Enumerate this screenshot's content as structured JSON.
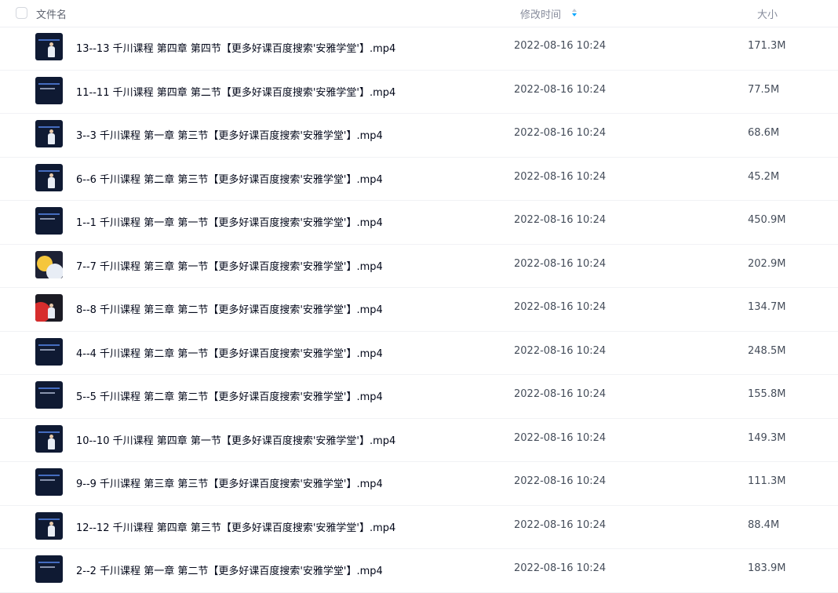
{
  "header": {
    "name_label": "文件名",
    "time_label": "修改时间",
    "size_label": "大小"
  },
  "files": [
    {
      "name": "13--13 千川课程 第四章 第四节【更多好课百度搜索'安雅学堂'】.mp4",
      "time": "2022-08-16 10:24",
      "size": "171.3M",
      "thumb": "presenter"
    },
    {
      "name": "11--11 千川课程 第四章 第二节【更多好课百度搜索'安雅学堂'】.mp4",
      "time": "2022-08-16 10:24",
      "size": "77.5M",
      "thumb": "slide"
    },
    {
      "name": "3--3 千川课程 第一章 第三节【更多好课百度搜索'安雅学堂'】.mp4",
      "time": "2022-08-16 10:24",
      "size": "68.6M",
      "thumb": "presenter"
    },
    {
      "name": "6--6 千川课程 第二章 第三节【更多好课百度搜索'安雅学堂'】.mp4",
      "time": "2022-08-16 10:24",
      "size": "45.2M",
      "thumb": "presenter"
    },
    {
      "name": "1--1 千川课程 第一章 第一节【更多好课百度搜索'安雅学堂'】.mp4",
      "time": "2022-08-16 10:24",
      "size": "450.9M",
      "thumb": "slide"
    },
    {
      "name": "7--7 千川课程 第三章 第一节【更多好课百度搜索'安雅学堂'】.mp4",
      "time": "2022-08-16 10:24",
      "size": "202.9M",
      "thumb": "yellow"
    },
    {
      "name": "8--8 千川课程 第三章 第二节【更多好课百度搜索'安雅学堂'】.mp4",
      "time": "2022-08-16 10:24",
      "size": "134.7M",
      "thumb": "red"
    },
    {
      "name": "4--4 千川课程 第二章 第一节【更多好课百度搜索'安雅学堂'】.mp4",
      "time": "2022-08-16 10:24",
      "size": "248.5M",
      "thumb": "slide"
    },
    {
      "name": "5--5 千川课程 第二章 第二节【更多好课百度搜索'安雅学堂'】.mp4",
      "time": "2022-08-16 10:24",
      "size": "155.8M",
      "thumb": "slide"
    },
    {
      "name": "10--10 千川课程 第四章 第一节【更多好课百度搜索'安雅学堂'】.mp4",
      "time": "2022-08-16 10:24",
      "size": "149.3M",
      "thumb": "presenter"
    },
    {
      "name": "9--9 千川课程 第三章 第三节【更多好课百度搜索'安雅学堂'】.mp4",
      "time": "2022-08-16 10:24",
      "size": "111.3M",
      "thumb": "slide"
    },
    {
      "name": "12--12 千川课程 第四章 第三节【更多好课百度搜索'安雅学堂'】.mp4",
      "time": "2022-08-16 10:24",
      "size": "88.4M",
      "thumb": "presenter"
    },
    {
      "name": "2--2 千川课程 第一章 第二节【更多好课百度搜索'安雅学堂'】.mp4",
      "time": "2022-08-16 10:24",
      "size": "183.9M",
      "thumb": "slide"
    }
  ],
  "colors": {
    "sort_active": "#06a7ff",
    "text_primary": "#03081a",
    "text_secondary": "#878c9c"
  }
}
